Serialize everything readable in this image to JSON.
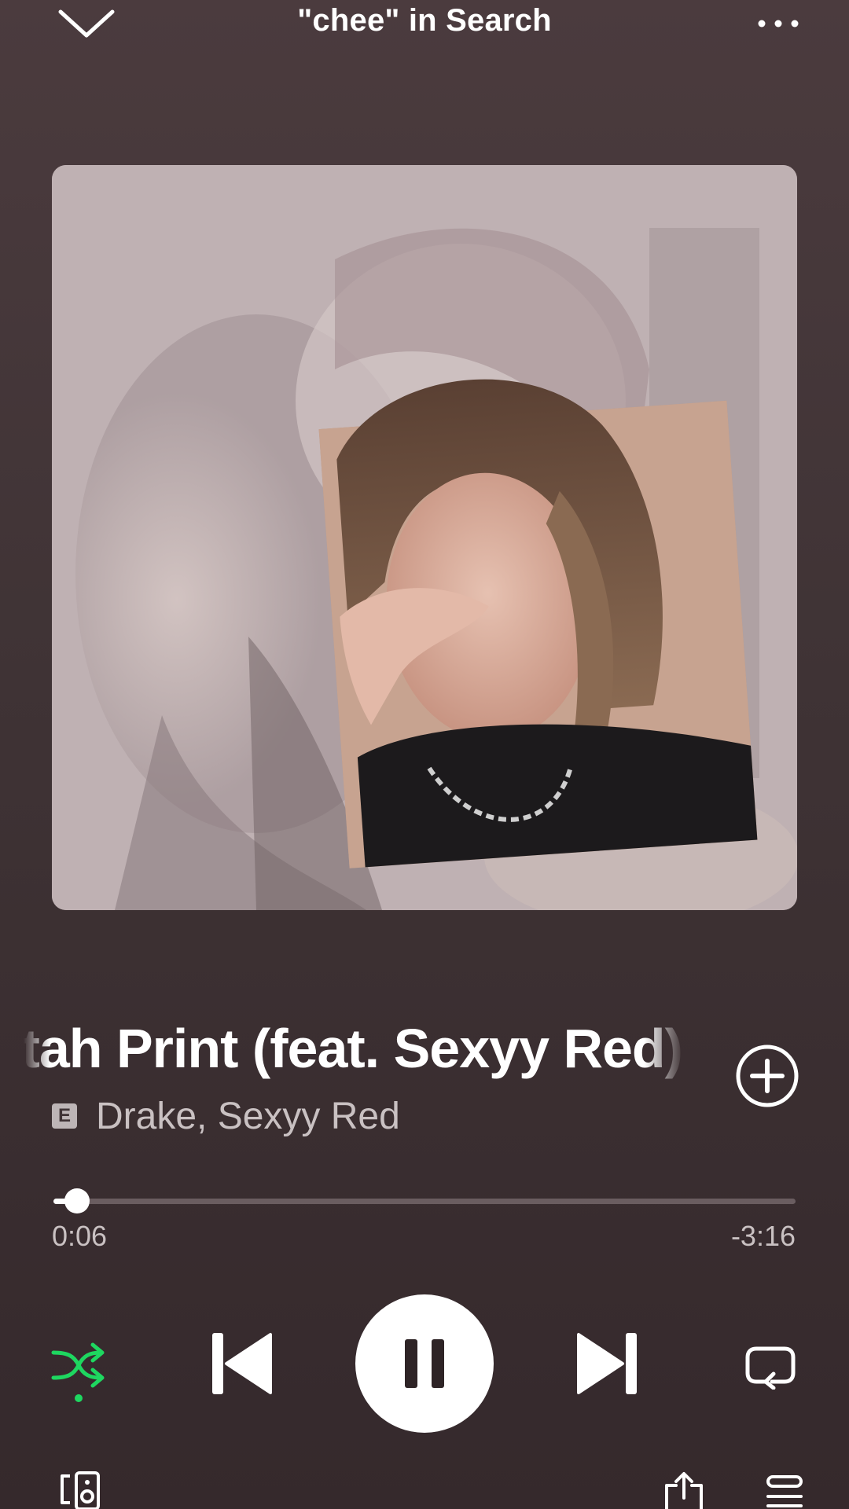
{
  "header": {
    "context_title": "\"chee\" in Search",
    "collapse_icon": "chevron-down-icon",
    "more_icon": "more-horizontal-icon"
  },
  "cover": {
    "icon": "album-art"
  },
  "track": {
    "title": "Cheetah Print (feat. Sexyy Red)",
    "explicit_badge": "E",
    "artists": "Drake, Sexyy Red",
    "add_icon": "add-circle-icon"
  },
  "playback": {
    "progress_fraction": 0.032,
    "elapsed": "0:06",
    "remaining": "-3:16",
    "shuffle_on": true,
    "state_icon": "pause-icon"
  },
  "colors": {
    "accent": "#1ed760",
    "background": "#3f3335"
  },
  "bottom_bar": {
    "devices_icon": "connect-device-icon",
    "share_icon": "share-icon",
    "queue_icon": "queue-icon"
  }
}
